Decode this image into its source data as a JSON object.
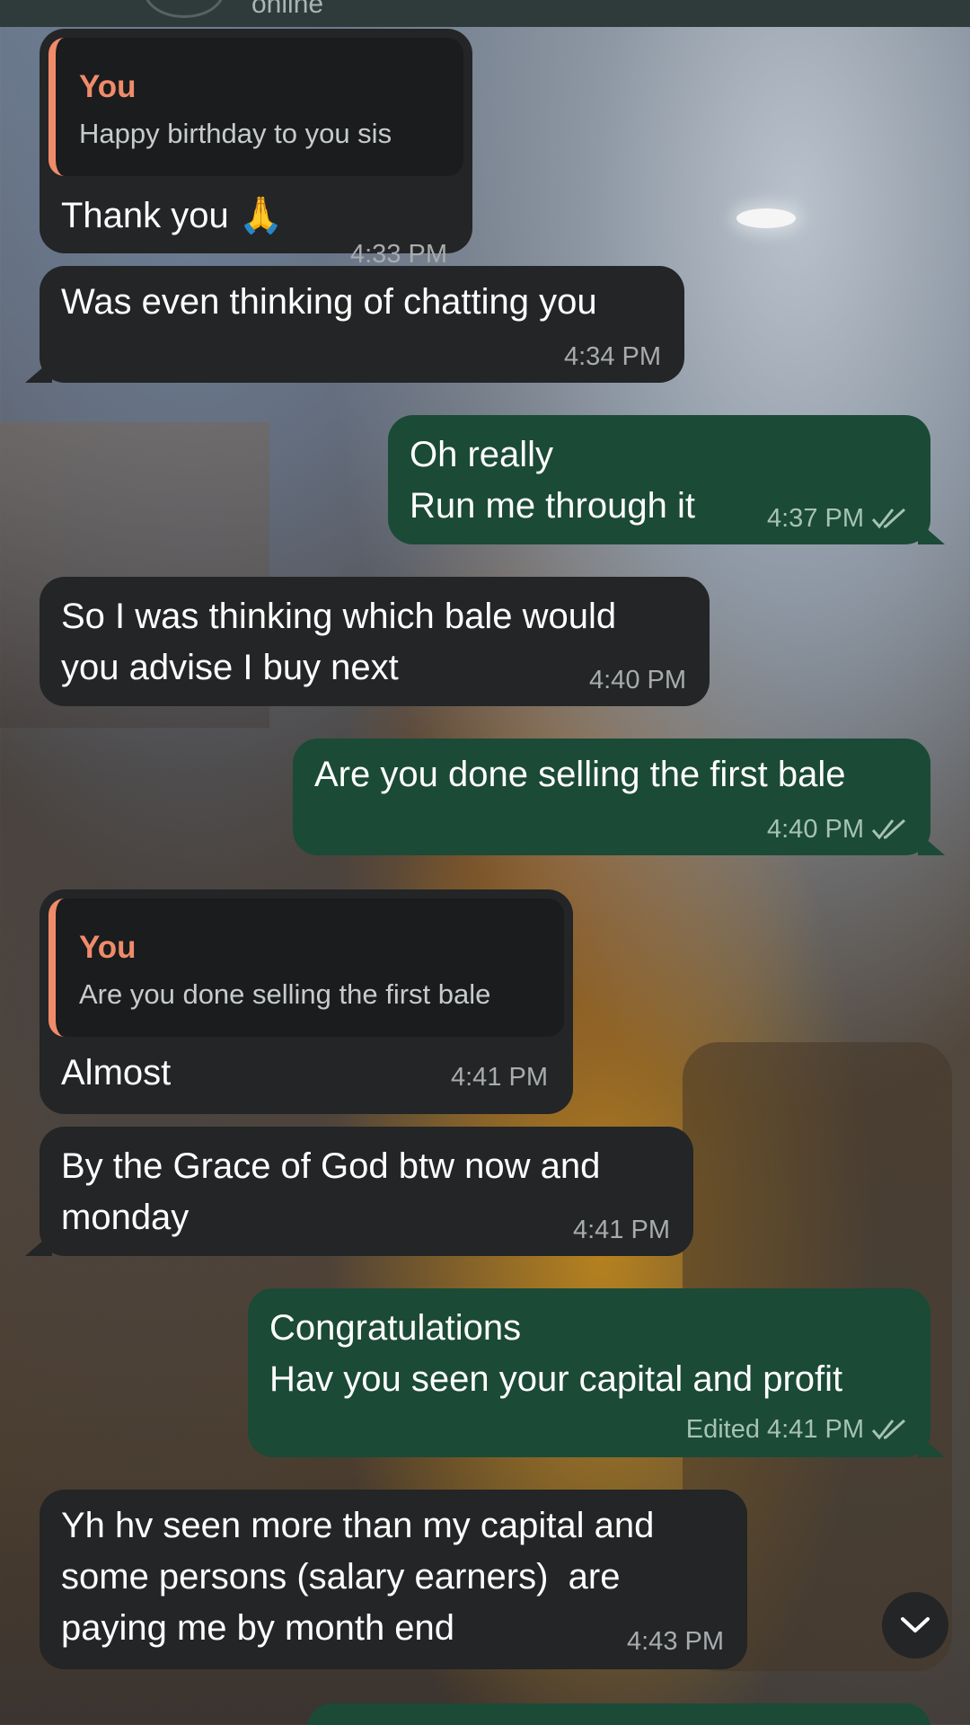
{
  "header": {
    "status": "online"
  },
  "messages": [
    {
      "id": "m1",
      "direction": "in",
      "quote": {
        "name": "You",
        "text": "Happy birthday to you sis"
      },
      "text": "Thank you 🙏",
      "time": "4:33 PM"
    },
    {
      "id": "m2",
      "direction": "in",
      "text": "Was even thinking of chatting you",
      "time": "4:34 PM"
    },
    {
      "id": "m3",
      "direction": "out",
      "text": "Oh really\nRun me through it",
      "time": "4:37 PM",
      "status": "read"
    },
    {
      "id": "m4",
      "direction": "in",
      "text": "So I was thinking which bale would\nyou advise I buy next",
      "time": "4:40 PM"
    },
    {
      "id": "m5",
      "direction": "out",
      "text": "Are you done selling the first bale",
      "time": "4:40 PM",
      "status": "read"
    },
    {
      "id": "m6",
      "direction": "in",
      "quote": {
        "name": "You",
        "text": "Are you done selling the first bale"
      },
      "text": "Almost",
      "time": "4:41 PM"
    },
    {
      "id": "m7",
      "direction": "in",
      "text": "By the Grace of God btw now and\nmonday",
      "time": "4:41 PM"
    },
    {
      "id": "m8",
      "direction": "out",
      "text": "Congratulations\nHav you seen your capital and profit",
      "edited": "Edited",
      "time": "4:41 PM",
      "status": "read"
    },
    {
      "id": "m9",
      "direction": "in",
      "text": "Yh hv seen more than my capital and\nsome persons (salary earners)  are\npaying me by month end",
      "time": "4:43 PM"
    }
  ],
  "colors": {
    "incoming_bubble": "#232526",
    "outgoing_bubble": "#1b4a37",
    "quote_accent": "#f08b6a",
    "read_tick": "#a6c2b6"
  },
  "icons": {
    "read_receipt": "double-check-icon",
    "scroll_down": "chevron-down-icon"
  }
}
